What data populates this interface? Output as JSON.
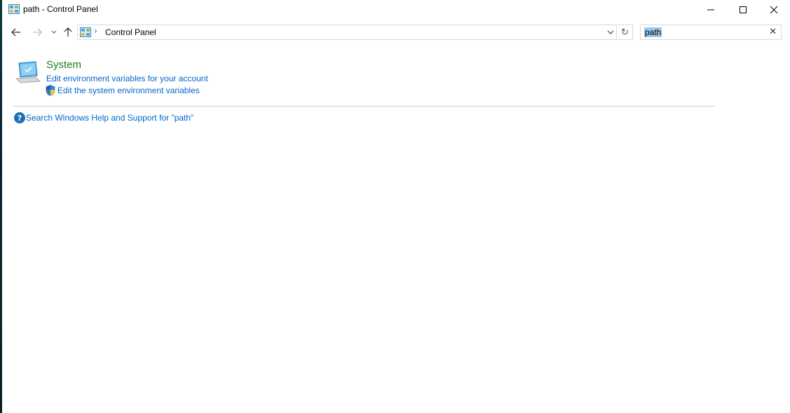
{
  "window": {
    "title": "path - Control Panel",
    "minimize": "minimize-icon",
    "maximize": "maximize-icon",
    "close": "close-icon"
  },
  "nav": {
    "back_icon": "arrow-left-icon",
    "forward_icon": "arrow-right-icon",
    "recent_icon": "chevron-down-icon",
    "up_icon": "arrow-up-icon"
  },
  "address": {
    "separator": "›",
    "crumb": "Control Panel",
    "refresh_glyph": "↻"
  },
  "search": {
    "value": "path",
    "clear_glyph": "✕"
  },
  "results": {
    "group_title": "System",
    "link_user_env": "Edit environment variables for your account",
    "link_system_env": "Edit the system environment variables",
    "help_glyph": "?",
    "help_link": "Search Windows Help and Support for \"path\""
  },
  "colors": {
    "link": "#0066cc",
    "group_title": "#1e7a1e",
    "selection": "#99c9ef",
    "help_icon": "#1f6fb5"
  }
}
